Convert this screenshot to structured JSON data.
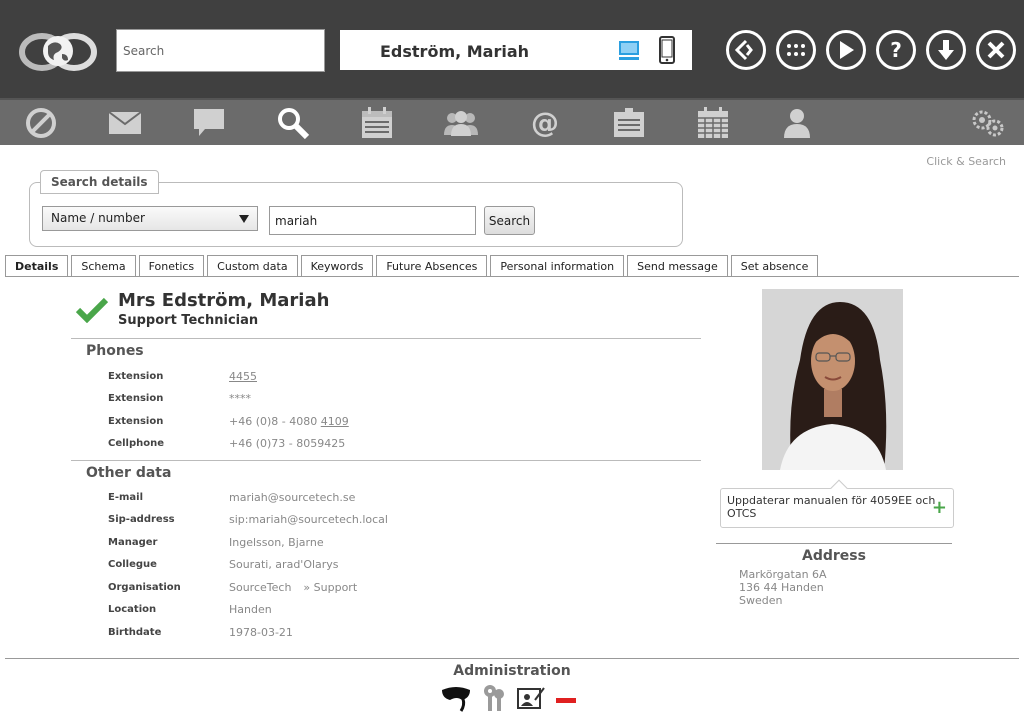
{
  "header": {
    "search_placeholder": "Search",
    "user_name": "Edström, Mariah",
    "actions": [
      "switch-icon",
      "apps-icon",
      "play-icon",
      "help-icon",
      "download-icon",
      "close-icon"
    ]
  },
  "nav": {
    "items": [
      "block-icon",
      "mail-icon",
      "chat-icon",
      "search-icon",
      "calendar-icon",
      "group-icon",
      "at-icon",
      "schedule-icon",
      "month-icon",
      "person-icon",
      "settings-icon"
    ]
  },
  "click_search": "Click & Search",
  "search_details": {
    "legend": "Search details",
    "select_value": "Name / number",
    "input_value": "mariah",
    "button_label": "Search"
  },
  "tabs": [
    {
      "label": "Details",
      "active": true
    },
    {
      "label": "Schema"
    },
    {
      "label": "Fonetics"
    },
    {
      "label": "Custom data"
    },
    {
      "label": "Keywords"
    },
    {
      "label": "Future Absences"
    },
    {
      "label": "Personal information"
    },
    {
      "label": "Send message"
    },
    {
      "label": "Set absence"
    }
  ],
  "person": {
    "name": "Mrs Edström, Mariah",
    "title": "Support Technician"
  },
  "phones": {
    "title": "Phones",
    "rows": [
      {
        "label": "Extension",
        "value": "4455"
      },
      {
        "label": "Extension",
        "value": "****"
      },
      {
        "label": "Extension",
        "value": "+46 (0)8 - 4080 ",
        "link": "4109"
      },
      {
        "label": "Cellphone",
        "value": "+46 (0)73 - 8059425"
      }
    ]
  },
  "other": {
    "title": "Other data",
    "rows": [
      {
        "label": "E-mail",
        "value": "mariah@sourcetech.se"
      },
      {
        "label": "Sip-address",
        "value": "sip:mariah@sourcetech.local"
      },
      {
        "label": "Manager",
        "value": "Ingelsson, Bjarne"
      },
      {
        "label": "Collegue",
        "value": "Sourati, arad'Olarys"
      },
      {
        "label": "Organisation",
        "value": "SourceTech",
        "extra": "» Support"
      },
      {
        "label": "Location",
        "value": "Handen"
      },
      {
        "label": "Birthdate",
        "value": "1978-03-21"
      }
    ]
  },
  "status_note": "Uppdaterar manualen för 4059EE och OTCS",
  "address": {
    "title": "Address",
    "lines": [
      "Markörgatan 6A",
      "136 44 Handen",
      "Sweden"
    ]
  },
  "administration": {
    "title": "Administration"
  },
  "colors": {
    "topbar": "#404040",
    "navbar": "#6b6b6b",
    "check": "#4aa64a",
    "remove": "#e02020",
    "accent_blue": "#2b9fe0"
  }
}
